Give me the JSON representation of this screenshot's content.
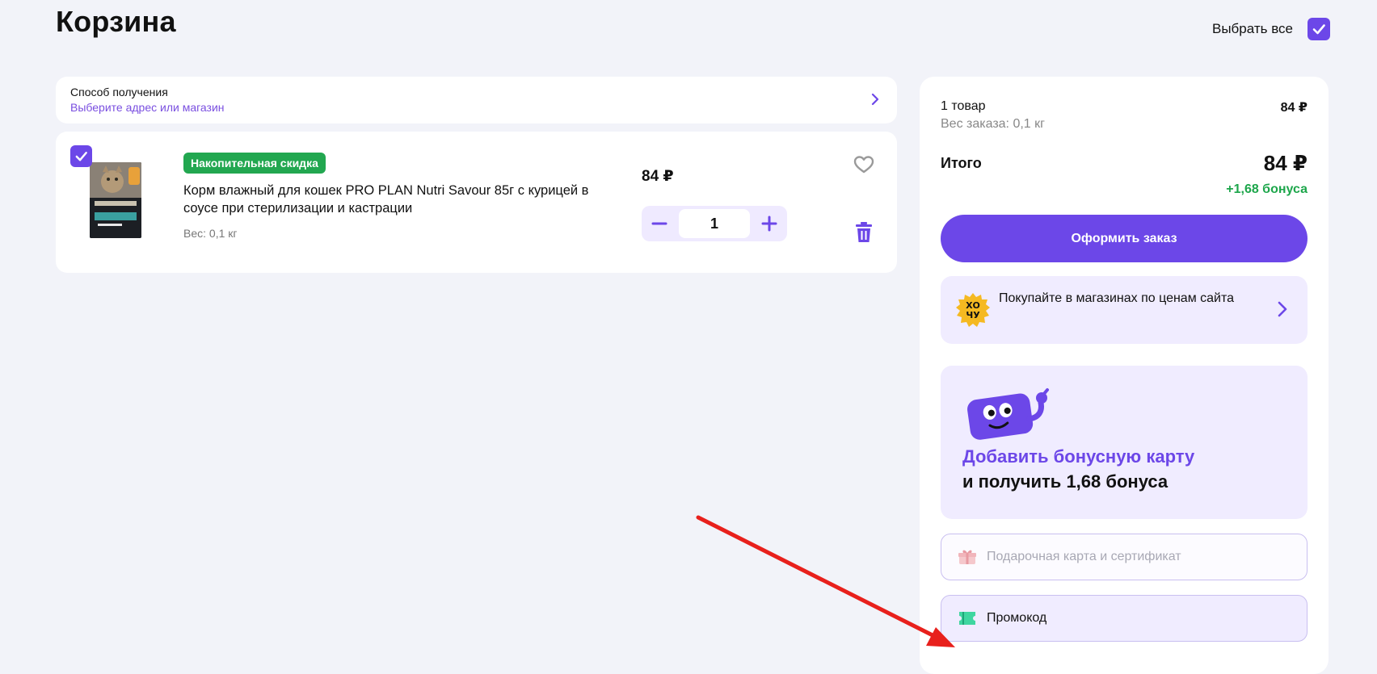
{
  "header": {
    "title": "Корзина",
    "select_all_label": "Выбрать все",
    "select_all_checked": true
  },
  "delivery": {
    "title": "Способ получения",
    "subtitle": "Выберите адрес или магазин"
  },
  "cart_item": {
    "checked": true,
    "badge": "Накопительная скидка",
    "name": "Корм влажный для кошек PRO PLAN Nutri Savour 85г с курицей в соусе при стерилизации и кастрации",
    "weight": "Вес: 0,1 кг",
    "price": "84 ₽",
    "quantity": "1"
  },
  "summary": {
    "count": "1 товар",
    "count_price": "84 ₽",
    "weight": "Вес заказа: 0,1 кг",
    "total_label": "Итого",
    "total": "84 ₽",
    "bonus": "+1,68 бонуса",
    "order_button": "Оформить заказ",
    "store_promo": "Покупайте в магазинах по ценам сайта",
    "bonus_card_title": "Добавить бонусную карту",
    "bonus_card_subtitle": "и получить 1,68 бонуса",
    "gift_placeholder": "Подарочная карта и сертификат",
    "promo_label": "Промокод"
  },
  "colors": {
    "accent": "#6c47e8",
    "bonus_green": "#1da64b",
    "badge_green": "#22a750",
    "annotation_arrow": "#e8201c"
  }
}
